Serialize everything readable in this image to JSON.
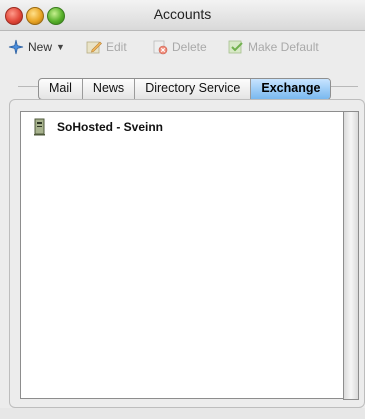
{
  "window": {
    "title": "Accounts"
  },
  "toolbar": {
    "new_label": "New",
    "edit_label": "Edit",
    "delete_label": "Delete",
    "make_default_label": "Make Default"
  },
  "tabs": [
    {
      "label": "Mail",
      "active": false
    },
    {
      "label": "News",
      "active": false
    },
    {
      "label": "Directory Service",
      "active": false
    },
    {
      "label": "Exchange",
      "active": true
    }
  ],
  "accounts": [
    {
      "name": "SoHosted - Sveinn",
      "icon": "server-icon"
    }
  ]
}
